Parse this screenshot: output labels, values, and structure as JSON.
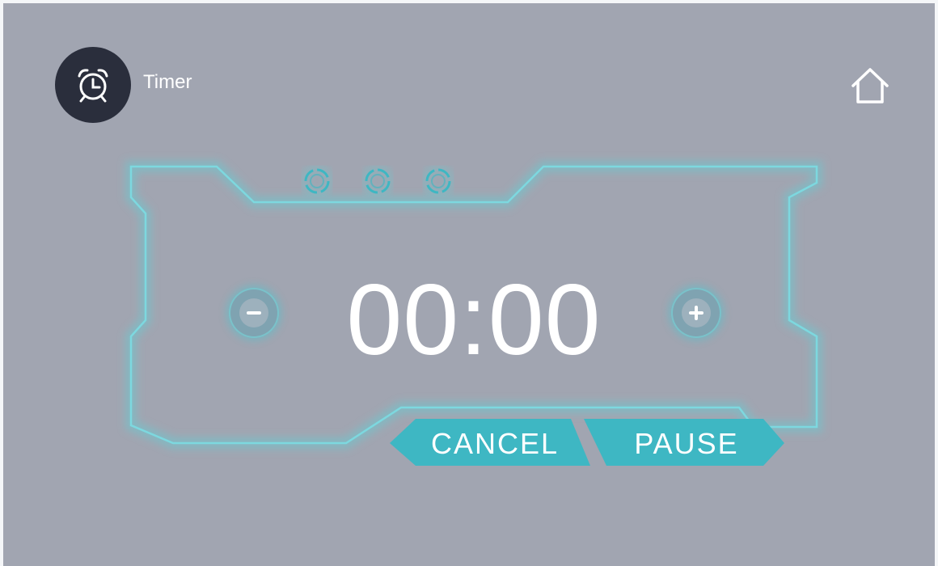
{
  "app": {
    "title": "Timer",
    "icon": "alarm-clock-icon"
  },
  "header": {
    "home_icon": "home-icon"
  },
  "timer": {
    "display": "00:00",
    "decrement_icon": "minus-icon",
    "increment_icon": "plus-icon",
    "indicators": [
      "ring-indicator",
      "ring-indicator",
      "ring-indicator"
    ]
  },
  "actions": {
    "cancel_label": "CANCEL",
    "pause_label": "PAUSE"
  },
  "colors": {
    "background": "#a1a5b1",
    "badge": "#2a2e3c",
    "accent": "#3eb7c3",
    "frame_glow": "#5fd0d8",
    "text": "#ffffff"
  }
}
